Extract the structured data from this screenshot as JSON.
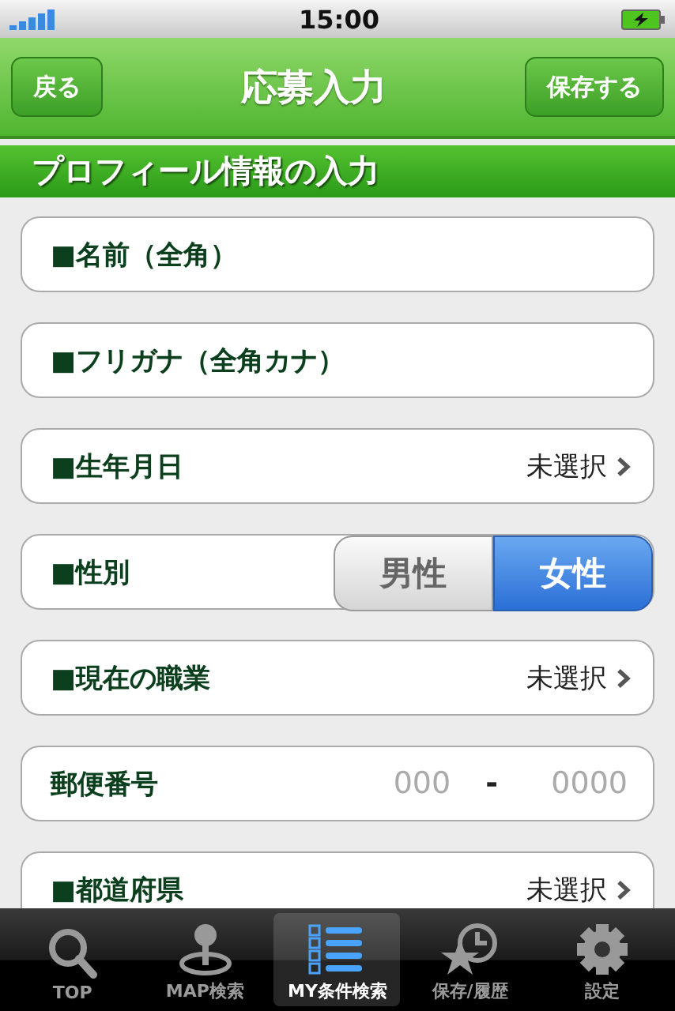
{
  "status_bar": {
    "time": "15:00"
  },
  "nav_bar": {
    "back": "戻る",
    "title": "応募入力",
    "save": "保存する"
  },
  "section": {
    "title": "プロフィール情報の入力"
  },
  "fields": [
    {
      "kind": "text",
      "label": "■名前（全角）"
    },
    {
      "kind": "text",
      "label": "■フリガナ（全角カナ）"
    },
    {
      "kind": "select",
      "label": "■生年月日",
      "value": "未選択"
    },
    {
      "kind": "segmented",
      "label": "■性別",
      "options": [
        {
          "label": "男性",
          "selected": false
        },
        {
          "label": "女性",
          "selected": true
        }
      ]
    },
    {
      "kind": "select",
      "label": "■現在の職業",
      "value": "未選択"
    },
    {
      "kind": "postal",
      "label": "郵便番号",
      "placeholder_1": "000",
      "separator": "-",
      "placeholder_2": "0000"
    },
    {
      "kind": "select",
      "label": "■都道府県",
      "value": "未選択"
    }
  ],
  "tab_bar": [
    {
      "label": "TOP",
      "kind": "search",
      "selected": false
    },
    {
      "label": "MAP検索",
      "kind": "pin",
      "selected": false
    },
    {
      "label": "MY条件検索",
      "kind": "list",
      "selected": true
    },
    {
      "label": "保存/履歴",
      "kind": "history",
      "selected": false
    },
    {
      "label": "設定",
      "kind": "gear",
      "selected": false
    }
  ]
}
